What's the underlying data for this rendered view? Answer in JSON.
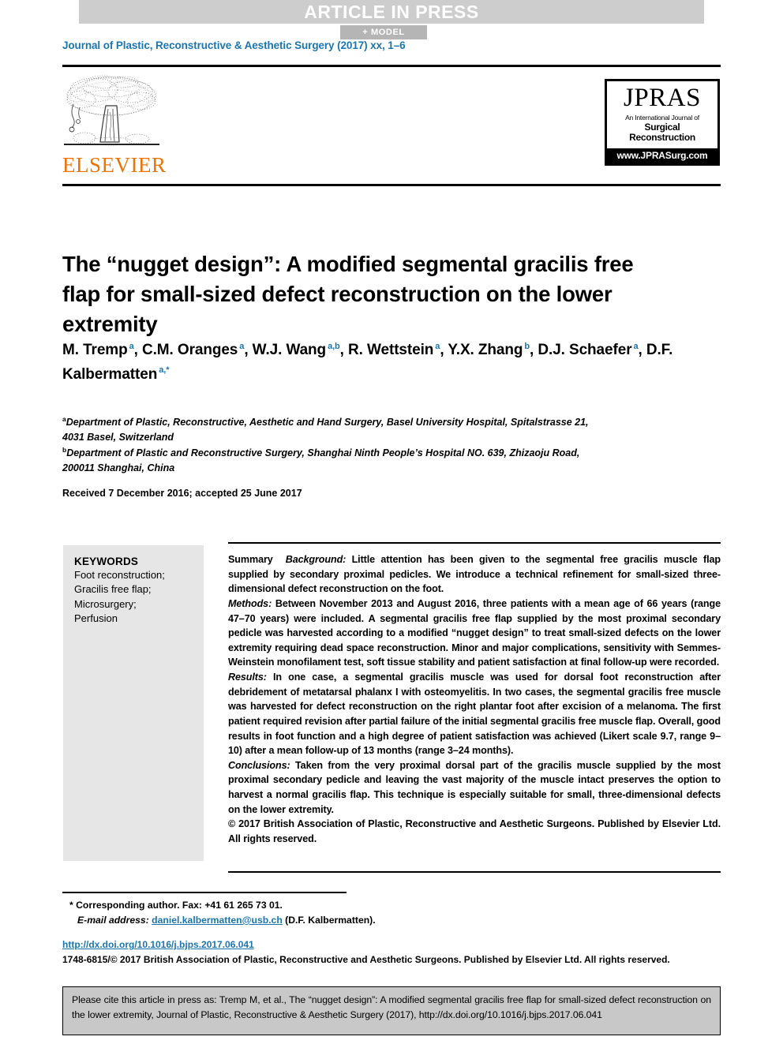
{
  "banner": {
    "press_label": "ARTICLE IN PRESS",
    "model_label": "+ MODEL",
    "banner_bg": "#cdcdcd",
    "model_bg": "#b5b5b5"
  },
  "journal": {
    "header_line": "Journal of Plastic, Reconstructive & Aesthetic Surgery (2017) xx, 1–6",
    "accent_color": "#1b75b0"
  },
  "publisher": {
    "elsevier_wordmark": "ELSEVIER",
    "elsevier_color": "#ec7404"
  },
  "jpras_logo": {
    "title": "JPRAS",
    "subtitle_line1": "An International Journal of",
    "subtitle_line2": "Surgical Reconstruction",
    "url": "www.JPRASurg.com"
  },
  "article": {
    "title": "The “nugget design”: A modified segmental gracilis free flap for small-sized defect reconstruction on the lower extremity",
    "authors": [
      {
        "name": "M. Tremp",
        "marks": "a",
        "sep": ", "
      },
      {
        "name": "C.M. Oranges",
        "marks": "a",
        "sep": ", "
      },
      {
        "name": "W.J. Wang",
        "marks": "a,b",
        "sep": ", "
      },
      {
        "name": "R. Wettstein",
        "marks": "a",
        "sep": ", "
      },
      {
        "name": "Y.X. Zhang",
        "marks": "b",
        "sep": ", "
      },
      {
        "name": "D.J. Schaefer",
        "marks": "a",
        "sep": ", "
      },
      {
        "name": "D.F. Kalbermatten",
        "marks": "a,*",
        "sep": ""
      }
    ],
    "affiliation_a_mark": "a",
    "affiliation_a": "Department of Plastic, Reconstructive, Aesthetic and Hand Surgery, Basel University Hospital, Spitalstrasse 21, 4031 Basel, Switzerland",
    "affiliation_b_mark": "b",
    "affiliation_b": "Department of Plastic and Reconstructive Surgery, Shanghai Ninth People’s Hospital NO. 639, Zhizaoju Road, 200011 Shanghai, China",
    "received": "Received 7 December 2016; accepted 25 June 2017"
  },
  "keywords": {
    "heading": "KEYWORDS",
    "items": "Foot reconstruction;\nGracilis free flap;\nMicrosurgery;\nPerfusion"
  },
  "abstract": {
    "summary_label": "Summary",
    "background_label": "Background:",
    "background_text": " Little attention has been given to the segmental free gracilis muscle flap supplied by secondary proximal pedicles. We introduce a technical refinement for small-sized three-dimensional defect reconstruction on the foot.",
    "methods_label": "Methods:",
    "methods_text": " Between November 2013 and August 2016, three patients with a mean age of 66 years (range 47–70 years) were included. A segmental gracilis free flap supplied by the most proximal secondary pedicle was harvested according to a modified “nugget design” to treat small-sized defects on the lower extremity requiring dead space reconstruction. Minor and major complications, sensitivity with Semmes-Weinstein monofilament test, soft tissue stability and patient satisfaction at final follow-up were recorded.",
    "results_label": "Results:",
    "results_text": " In one case, a segmental gracilis muscle was used for dorsal foot reconstruction after debridement of metatarsal phalanx I with osteomyelitis. In two cases, the segmental gracilis free muscle was harvested for defect reconstruction on the right plantar foot after excision of a melanoma. The first patient required revision after partial failure of the initial segmental gracilis free muscle flap. Overall, good results in foot function and a high degree of patient satisfaction was achieved (Likert scale 9.7, range 9–10) after a mean follow-up of 13 months (range 3–24 months).",
    "conclusions_label": "Conclusions:",
    "conclusions_text": " Taken from the very proximal dorsal part of the gracilis muscle supplied by the most proximal secondary pedicle and leaving the vast majority of the muscle intact preserves the option to harvest a normal gracilis flap. This technique is especially suitable for small, three-dimensional defects on the lower extremity.",
    "copyright": "© 2017 British Association of Plastic, Reconstructive and Aesthetic Surgeons. Published by Elsevier Ltd. All rights reserved."
  },
  "footer": {
    "corresponding_author": "* Corresponding author. Fax: +41 61 265 73 01.",
    "email_label": "E-mail address:",
    "email": "daniel.kalbermatten@usb.ch",
    "email_suffix": " (D.F. Kalbermatten).",
    "doi": "http://dx.doi.org/10.1016/j.bjps.2017.06.041",
    "issn_line": "1748-6815/© 2017 British Association of Plastic, Reconstructive and Aesthetic Surgeons. Published by Elsevier Ltd. All rights reserved."
  },
  "citation": {
    "text": "Please cite this article in press as: Tremp M, et al., The “nugget design”: A modified segmental gracilis free flap for small-sized defect reconstruction on the lower extremity, Journal of Plastic, Reconstructive & Aesthetic Surgery (2017), http://dx.doi.org/10.1016/j.bjps.2017.06.041"
  }
}
